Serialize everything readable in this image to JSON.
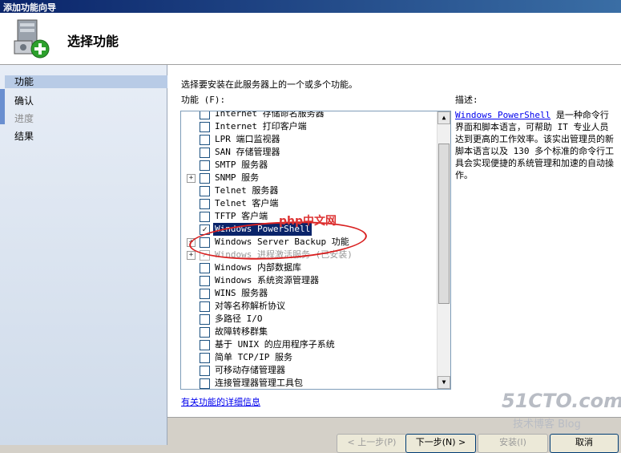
{
  "window": {
    "title": "添加功能向导"
  },
  "header": {
    "title": "选择功能"
  },
  "steps": [
    {
      "label": "功能",
      "state": "active"
    },
    {
      "label": "确认",
      "state": "normal"
    },
    {
      "label": "进度",
      "state": "dim"
    },
    {
      "label": "结果",
      "state": "normal"
    }
  ],
  "main": {
    "prompt": "选择要安装在此服务器上的一个或多个功能。",
    "features_label": "功能 (F):",
    "features": [
      {
        "label": "Internet 存储命名服务器",
        "checked": false,
        "expandable": false
      },
      {
        "label": "Internet 打印客户端",
        "checked": false,
        "expandable": false
      },
      {
        "label": "LPR 端口监视器",
        "checked": false,
        "expandable": false
      },
      {
        "label": "SAN 存储管理器",
        "checked": false,
        "expandable": false
      },
      {
        "label": "SMTP 服务器",
        "checked": false,
        "expandable": false
      },
      {
        "label": "SNMP 服务",
        "checked": false,
        "expandable": true
      },
      {
        "label": "Telnet 服务器",
        "checked": false,
        "expandable": false
      },
      {
        "label": "Telnet 客户端",
        "checked": false,
        "expandable": false
      },
      {
        "label": "TFTP 客户端",
        "checked": false,
        "expandable": false
      },
      {
        "label": "Windows PowerShell",
        "checked": true,
        "expandable": false,
        "selected": true
      },
      {
        "label": "Windows Server Backup 功能",
        "checked": false,
        "expandable": true
      },
      {
        "label": "Windows 进程激活服务 (已安装)",
        "checked": true,
        "expandable": true,
        "disabled": true
      },
      {
        "label": "Windows 内部数据库",
        "checked": false,
        "expandable": false
      },
      {
        "label": "Windows 系统资源管理器",
        "checked": false,
        "expandable": false
      },
      {
        "label": "WINS 服务器",
        "checked": false,
        "expandable": false
      },
      {
        "label": "对等名称解析协议",
        "checked": false,
        "expandable": false
      },
      {
        "label": "多路径 I/O",
        "checked": false,
        "expandable": false
      },
      {
        "label": "故障转移群集",
        "checked": false,
        "expandable": false
      },
      {
        "label": "基于 UNIX 的应用程序子系统",
        "checked": false,
        "expandable": false
      },
      {
        "label": "简单 TCP/IP 服务",
        "checked": false,
        "expandable": false
      },
      {
        "label": "可移动存储管理器",
        "checked": false,
        "expandable": false
      },
      {
        "label": "连接管理器管理工具包",
        "checked": false,
        "expandable": false
      }
    ],
    "more_info_link": "有关功能的详细信息",
    "description_label": "描述:",
    "description_link": "Windows PowerShell",
    "description_text": " 是一种命令行界面和脚本语言，可帮助 IT 专业人员达到更高的工作效率。该实出管理员的新脚本语言以及 130 多个标准的命令行工具会实现便捷的系统管理和加速的自动操作。"
  },
  "buttons": {
    "prev": "< 上一步(P)",
    "next": "下一步(N) >",
    "install": "安装(I)",
    "cancel": "取消"
  },
  "watermarks": {
    "php": "php中文网",
    "site": "51CTO.com",
    "blog": "技术博客 Blog"
  }
}
